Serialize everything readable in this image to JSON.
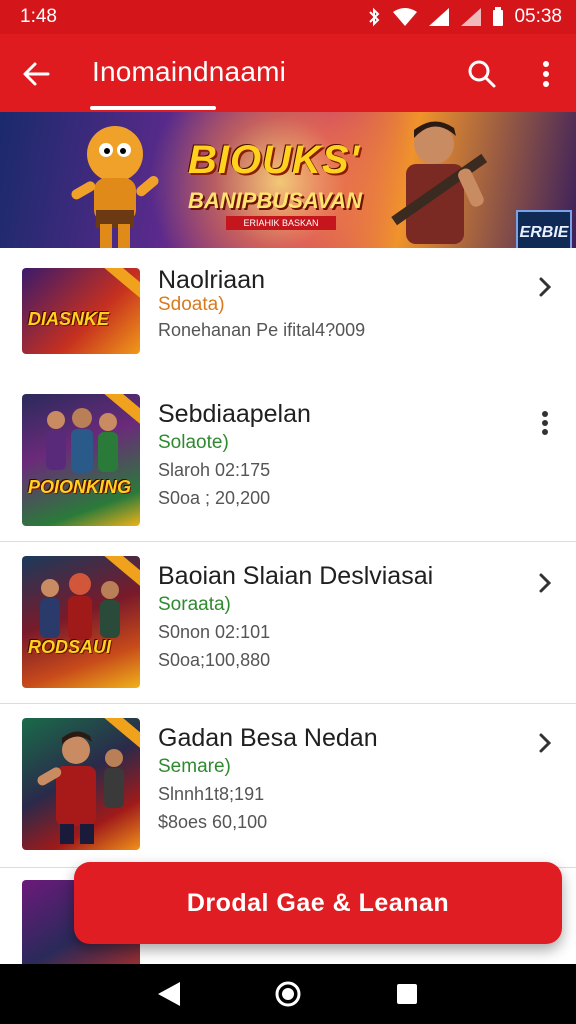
{
  "status_bar": {
    "time": "1:48",
    "clock_right": "05:38"
  },
  "app_bar": {
    "title": "Inomaindnaami"
  },
  "banner": {
    "headline": "BIOUKS'",
    "subline": "BANIPBUSAVAN",
    "strip": "ERIAHIK BASKAN",
    "badge": "ERBIE"
  },
  "items": [
    {
      "title": "Naolriaan",
      "subtitle": "Sdoata)",
      "subtitle_color": "#d87a1e",
      "meta1": "Ronehanan Pe ifital4?009",
      "meta2": "",
      "thumb_logo": "DIASNKE",
      "action_icon": "chevron-right-icon"
    },
    {
      "title": "Sebdiaapelan",
      "subtitle": "Solaote)",
      "subtitle_color": "#2f8a2f",
      "meta1": "Slaroh 02:175",
      "meta2": "S0oa ; 20,200",
      "thumb_logo": "POIONKING",
      "action_icon": "more-vertical-icon"
    },
    {
      "title": "Baoian Slaian Deslviasai",
      "subtitle": "Soraata)",
      "subtitle_color": "#2f8a2f",
      "meta1": "S0non 02:101",
      "meta2": "S0oa;100,880",
      "thumb_logo": "RODSAUI",
      "action_icon": "chevron-right-icon"
    },
    {
      "title": "Gadan Besa Nedan",
      "subtitle": "Semare)",
      "subtitle_color": "#2f8a2f",
      "meta1": "Slnnh1t8;191",
      "meta2": "$8oes 60,100",
      "thumb_logo": "",
      "action_icon": "chevron-right-icon"
    }
  ],
  "cta": {
    "label": "Drodal Gae & Leanan"
  }
}
